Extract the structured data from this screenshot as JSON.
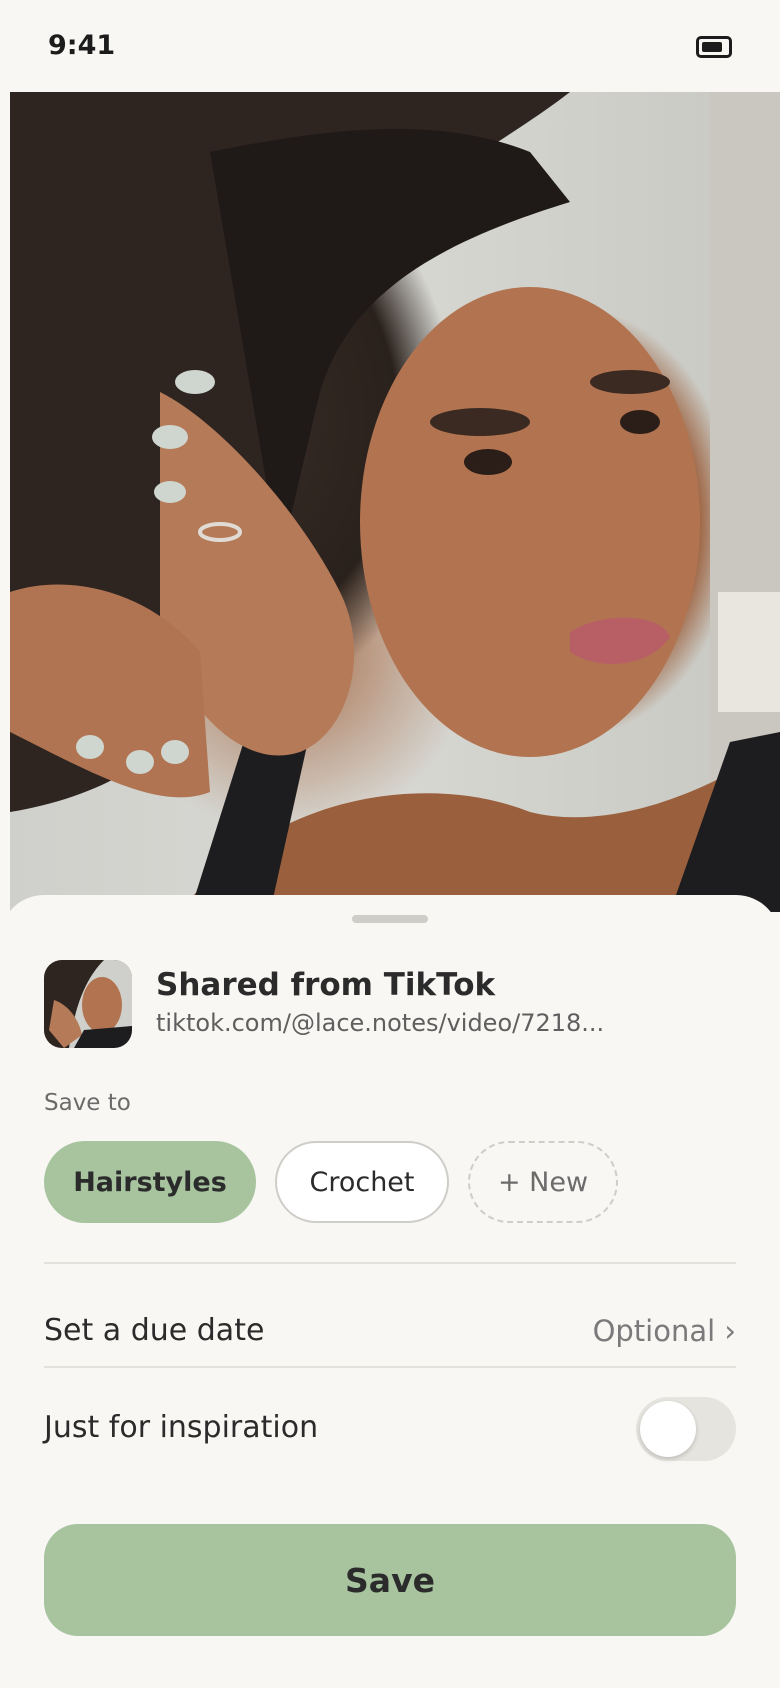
{
  "status_bar": {
    "time": "9:41",
    "battery_icon": "battery-icon"
  },
  "source": {
    "title": "Shared from TikTok",
    "url": "tiktok.com/@lace.notes/video/7218..."
  },
  "save_to": {
    "label": "Save to",
    "collections": [
      {
        "label": "Hairstyles",
        "selected": true
      },
      {
        "label": "Crochet",
        "selected": false
      }
    ],
    "new_label": "+ New"
  },
  "due_date": {
    "label": "Set a due date",
    "value": "Optional ›"
  },
  "inspiration": {
    "label": "Just for inspiration",
    "enabled": false
  },
  "save_button": {
    "label": "Save"
  },
  "colors": {
    "accent": "#a7c49f",
    "background": "#f8f7f4",
    "text": "#2b2b2b"
  }
}
